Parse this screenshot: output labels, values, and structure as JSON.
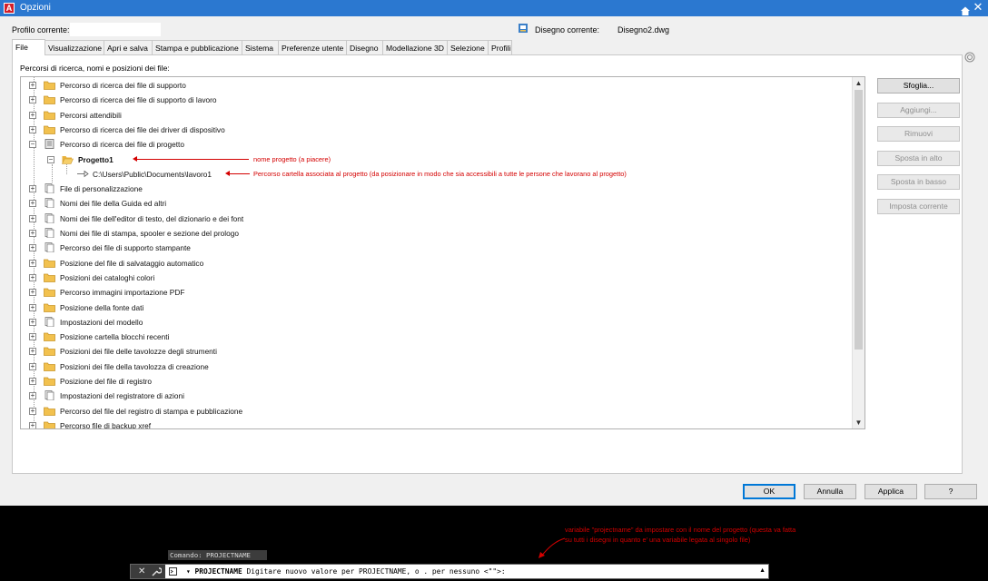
{
  "window": {
    "title": "Opzioni",
    "app_logo": "A"
  },
  "header": {
    "profile_label": "Profilo corrente:",
    "profile_value": "",
    "drawing_label": "Disegno corrente:",
    "drawing_value": "Disegno2.dwg"
  },
  "tabs": [
    {
      "label": "File"
    },
    {
      "label": "Visualizzazione"
    },
    {
      "label": "Apri e salva"
    },
    {
      "label": "Stampa e pubblicazione"
    },
    {
      "label": "Sistema"
    },
    {
      "label": "Preferenze utente"
    },
    {
      "label": "Disegno"
    },
    {
      "label": "Modellazione 3D"
    },
    {
      "label": "Selezione"
    },
    {
      "label": "Profili"
    }
  ],
  "panel": {
    "label": "Percorsi di ricerca, nomi e posizioni dei file:"
  },
  "tree": [
    {
      "label": "Percorso di ricerca dei file di supporto",
      "icon": "folder-icon",
      "expander": "+"
    },
    {
      "label": "Percorso di ricerca dei file di supporto di lavoro",
      "icon": "folder-icon",
      "expander": "+"
    },
    {
      "label": "Percorsi attendibili",
      "icon": "folder-icon",
      "expander": "+"
    },
    {
      "label": "Percorso di ricerca dei file dei driver di dispositivo",
      "icon": "folder-icon",
      "expander": "+"
    },
    {
      "label": "Percorso di ricerca dei file di progetto",
      "icon": "project-icon",
      "expander": "−"
    },
    {
      "label": "Progetto1",
      "icon": "open-folder-icon",
      "expander": "−",
      "level": 1
    },
    {
      "label": "C:\\Users\\Public\\Documents\\lavoro1",
      "icon": "path-arrow-icon",
      "expander": "",
      "level": 2
    },
    {
      "label": "File di personalizzazione",
      "icon": "file-icon",
      "expander": "+"
    },
    {
      "label": "Nomi dei file della Guida ed altri",
      "icon": "file-icon",
      "expander": "+"
    },
    {
      "label": "Nomi dei file dell'editor di testo, del dizionario e dei font",
      "icon": "file-icon",
      "expander": "+"
    },
    {
      "label": "Nomi dei file di stampa, spooler e sezione del prologo",
      "icon": "file-icon",
      "expander": "+"
    },
    {
      "label": "Percorso dei file di supporto stampante",
      "icon": "file-icon",
      "expander": "+"
    },
    {
      "label": "Posizione del file di salvataggio automatico",
      "icon": "folder-icon",
      "expander": "+"
    },
    {
      "label": "Posizioni dei cataloghi colori",
      "icon": "folder-icon",
      "expander": "+"
    },
    {
      "label": "Percorso immagini importazione PDF",
      "icon": "folder-icon",
      "expander": "+"
    },
    {
      "label": "Posizione della fonte dati",
      "icon": "folder-icon",
      "expander": "+"
    },
    {
      "label": "Impostazioni del modello",
      "icon": "file-icon",
      "expander": "+"
    },
    {
      "label": "Posizione cartella blocchi recenti",
      "icon": "folder-icon",
      "expander": "+"
    },
    {
      "label": "Posizioni dei file delle tavolozze degli strumenti",
      "icon": "folder-icon",
      "expander": "+"
    },
    {
      "label": "Posizioni dei file della tavolozza di creazione",
      "icon": "folder-icon",
      "expander": "+"
    },
    {
      "label": "Posizione del file di registro",
      "icon": "folder-icon",
      "expander": "+"
    },
    {
      "label": "Impostazioni del registratore di azioni",
      "icon": "file-icon",
      "expander": "+"
    },
    {
      "label": "Percorso del file del registro di stampa e pubblicazione",
      "icon": "folder-icon",
      "expander": "+"
    },
    {
      "label": "Percorso file di backup xref",
      "icon": "folder-icon",
      "expander": "+"
    }
  ],
  "annotations": {
    "project_name": "nome progetto (a piacere)",
    "project_path": "Percorso cartella associata al progetto (da posizionare in modo che sia accessibili a tutte le persone che lavorano al progetto)",
    "command_note": "variabile \"projectname\" da impostare con il nome del progetto (questa va fatta su tutti i disegni in quanto e' una variabile legata al singolo file)"
  },
  "side_buttons": [
    {
      "label": "Sfoglia...",
      "enabled": true
    },
    {
      "label": "Aggiungi...",
      "enabled": false
    },
    {
      "label": "Rimuovi",
      "enabled": false
    },
    {
      "label": "Sposta in alto",
      "enabled": false
    },
    {
      "label": "Sposta in basso",
      "enabled": false
    },
    {
      "label": "Imposta corrente",
      "enabled": false
    }
  ],
  "bottom_buttons": {
    "ok": "OK",
    "cancel": "Annulla",
    "apply": "Applica",
    "help": "?"
  },
  "command_line": {
    "history": "Comando: PROJECTNAME",
    "command": "PROJECTNAME",
    "prompt": "Digitare nuovo valore per PROJECTNAME, o . per nessuno <\"\">:"
  },
  "colors": {
    "titlebar": "#2b78d0",
    "annotation": "#d40000",
    "folder": "#f2c14e"
  }
}
